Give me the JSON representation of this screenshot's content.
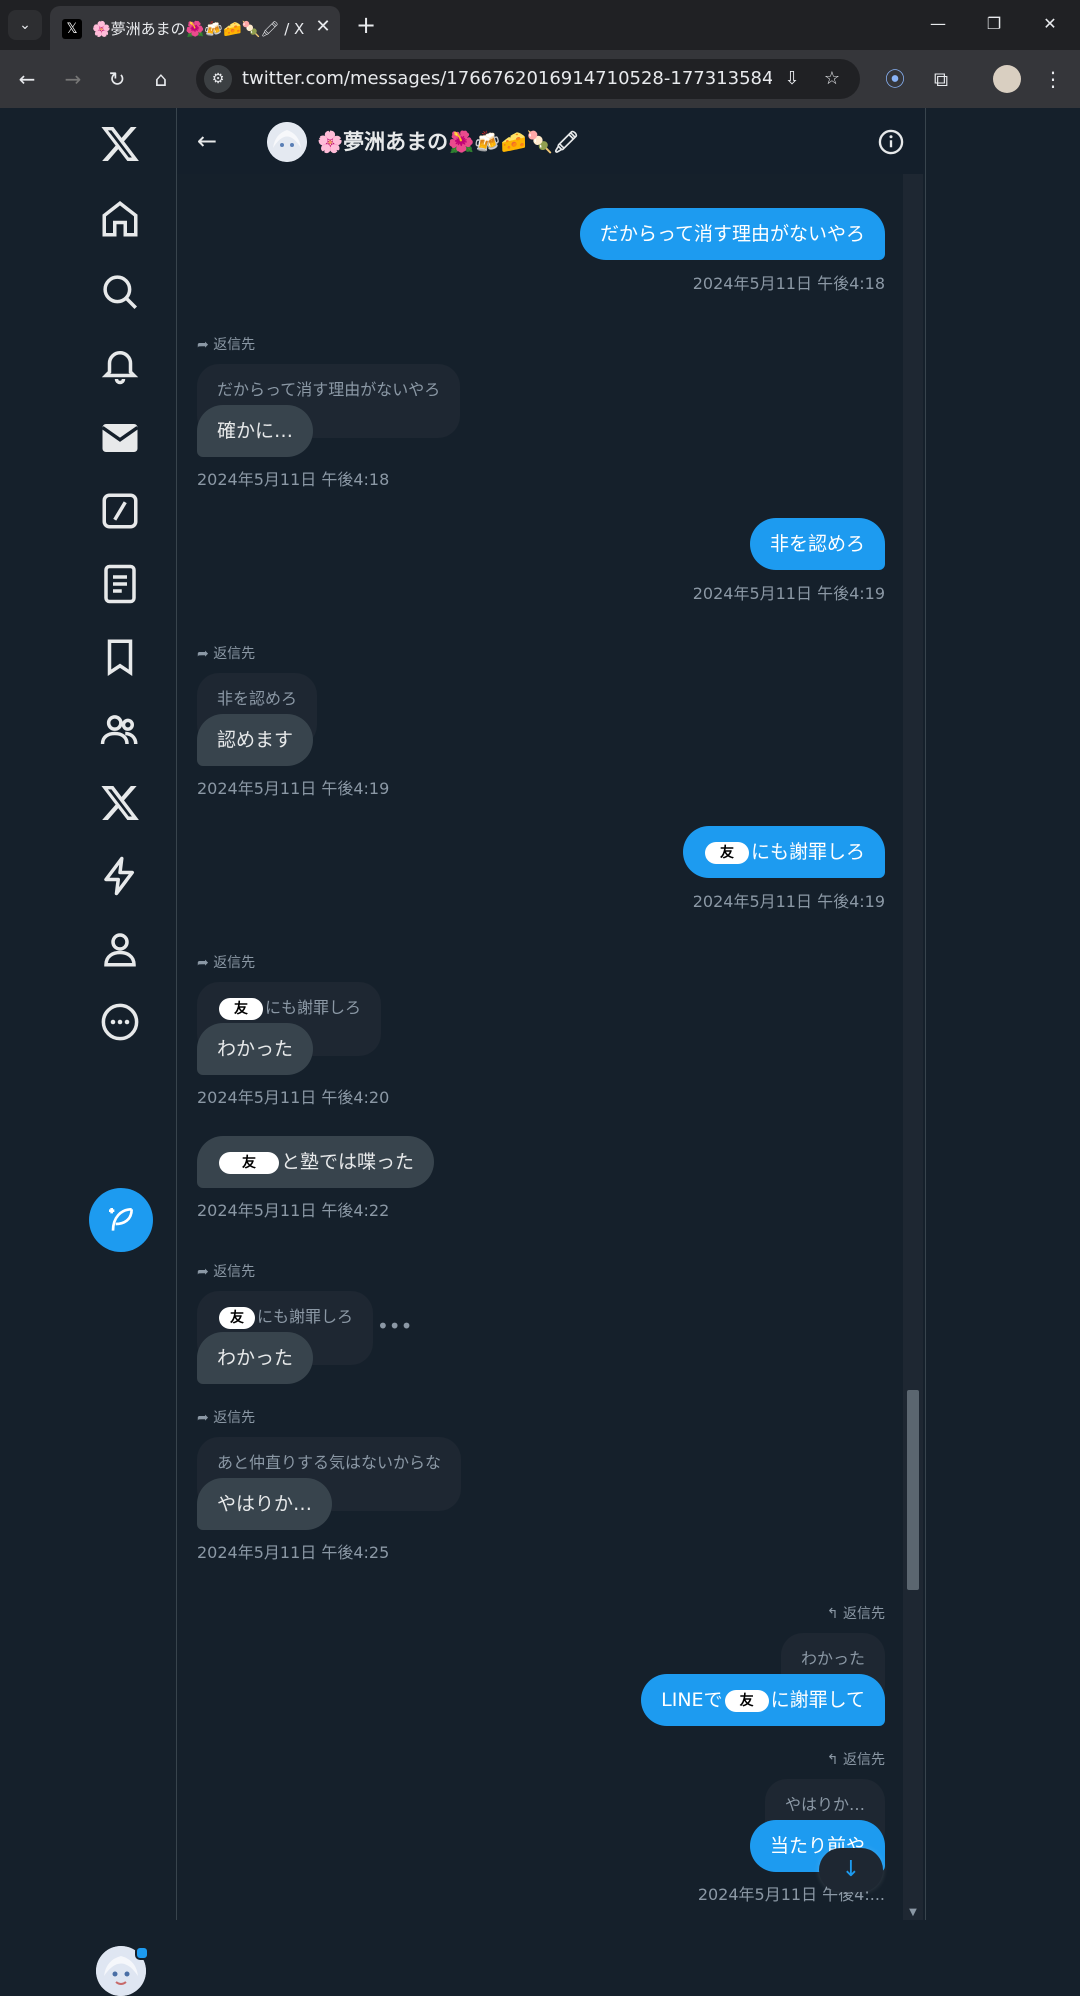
{
  "browser": {
    "tab_title": "🌸夢洲あまの🌺🍻🧀🍡🖍 / X",
    "url": "twitter.com/messages/1766762016914710528-1773135847753461...",
    "tab_close": "✕",
    "new_tab": "+"
  },
  "conversation": {
    "header_name": "🌸夢洲あまの🌺🍻🧀🍡🖍",
    "reply_label": "返信先",
    "messages": [
      {
        "text": "だからって消す理由がないやろ",
        "time": "2024年5月11日 午後4:18"
      },
      {
        "quote": "だからって消す理由がないやろ",
        "text": "確かに…",
        "time": "2024年5月11日 午後4:18"
      },
      {
        "text": "非を認めろ",
        "time": "2024年5月11日 午後4:19"
      },
      {
        "quote": "非を認めろ",
        "text": "認めます",
        "time": "2024年5月11日 午後4:19"
      },
      {
        "redact": "友",
        "text": "にも謝罪しろ",
        "time": "2024年5月11日 午後4:19"
      },
      {
        "quote_redact": "友",
        "quote": "にも謝罪しろ",
        "text": "わかった",
        "time": "2024年5月11日 午後4:20"
      },
      {
        "redact": "友",
        "text": "と塾では喋った",
        "time": "2024年5月11日 午後4:22"
      },
      {
        "quote_redact": "友",
        "quote": "にも謝罪しろ",
        "text": "わかった",
        "more": "•••"
      },
      {
        "quote": "あと仲直りする気はないからな",
        "text": "やはりか…",
        "time": "2024年5月11日 午後4:25"
      },
      {
        "quote": "わかった",
        "prefix": "LINEで",
        "redact": "友",
        "text": "に謝罪して"
      },
      {
        "quote": "やはりか…",
        "text": "当たり前や",
        "time": "2024年5月11日 午後4:..."
      }
    ]
  },
  "colors": {
    "accent": "#1d9bf0",
    "background": "#15202b",
    "received_bubble": "#38444d"
  },
  "icons": [
    "x-logo-icon",
    "home-icon",
    "search-icon",
    "bell-icon",
    "mail-icon",
    "grok-icon",
    "lists-icon",
    "bookmark-icon",
    "communities-icon",
    "premium-icon",
    "verified-orgs-icon",
    "profile-icon",
    "more-icon",
    "compose-icon"
  ]
}
